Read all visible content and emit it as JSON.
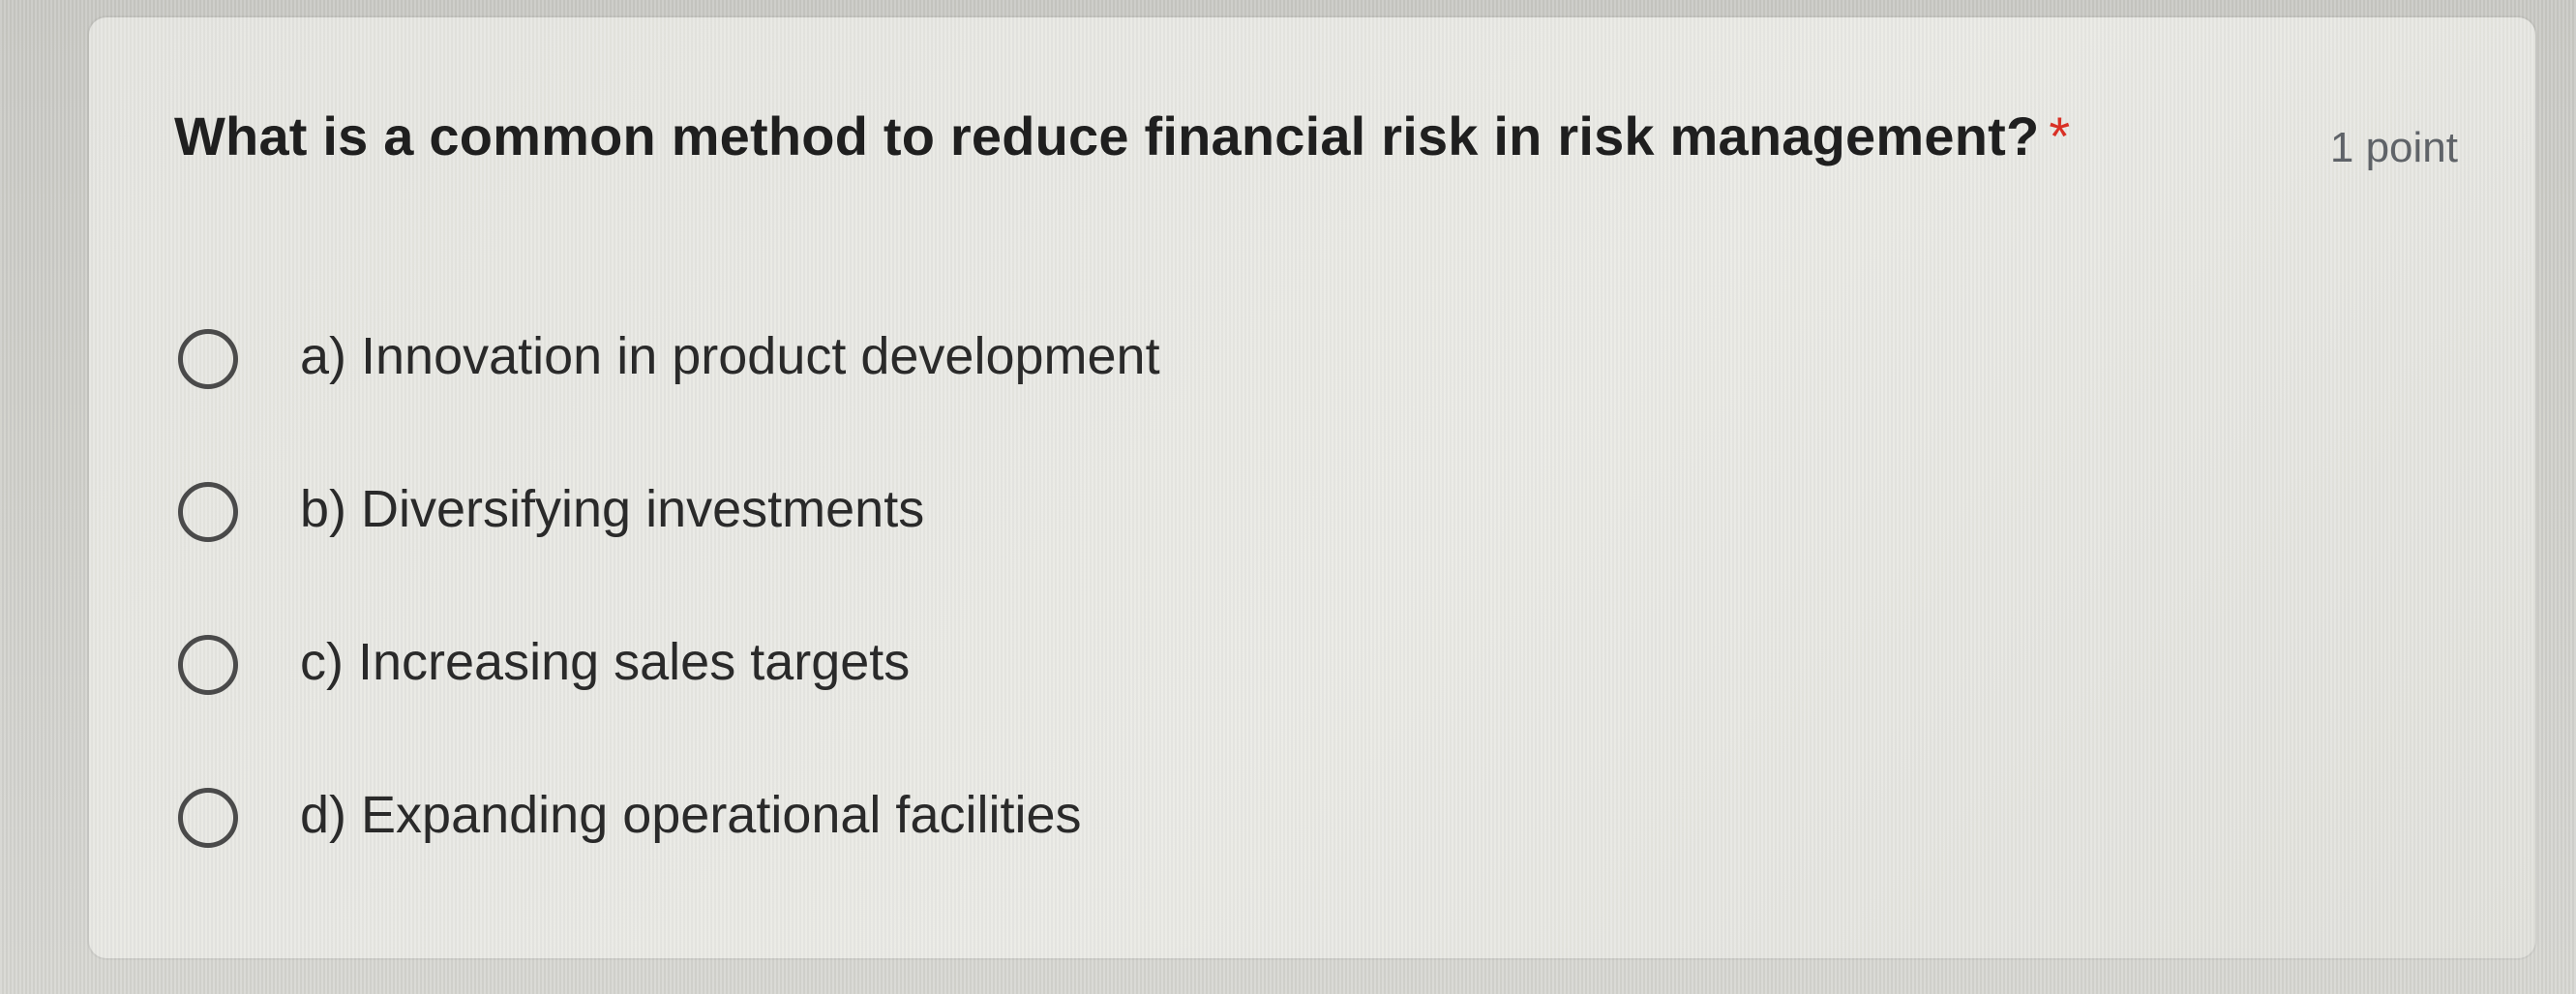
{
  "question": {
    "title": "What is a common method to reduce financial risk in risk management?",
    "required_marker": "*",
    "points": "1 point"
  },
  "options": [
    {
      "label": "a) Innovation in product development",
      "selected": false
    },
    {
      "label": "b) Diversifying investments",
      "selected": false
    },
    {
      "label": "c) Increasing sales targets",
      "selected": false
    },
    {
      "label": "d) Expanding operational facilities",
      "selected": false
    }
  ],
  "colors": {
    "required": "#d93025",
    "text": "#1f1f1f",
    "muted": "#5f6368",
    "radio_border": "#4a4a4a"
  },
  "icons": {
    "radio": "radio-unchecked-icon"
  }
}
